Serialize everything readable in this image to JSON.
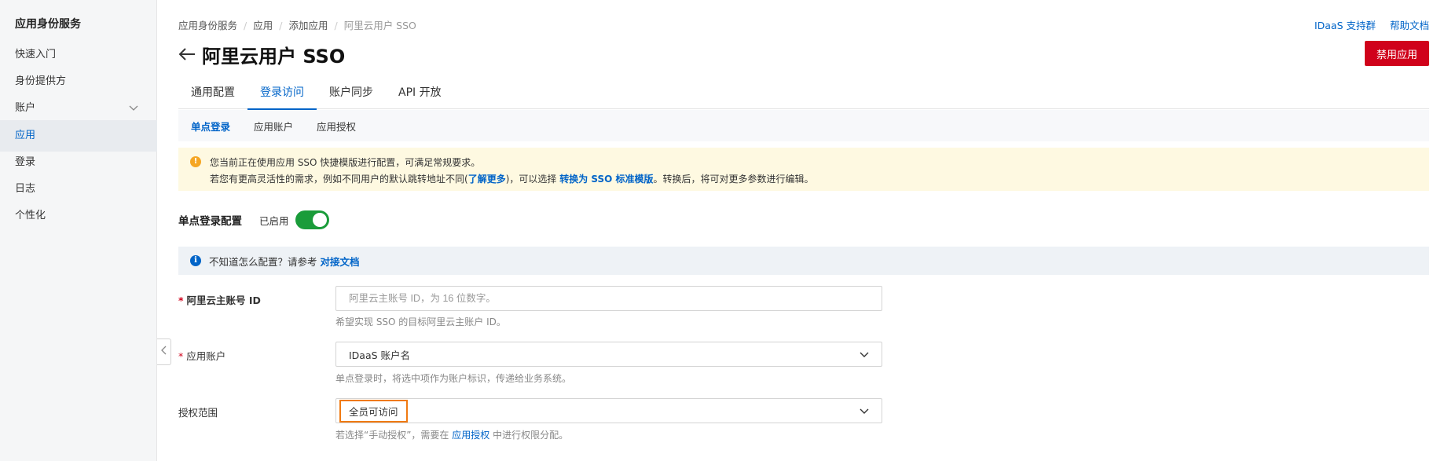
{
  "sidebar": {
    "title": "应用身份服务",
    "items": [
      {
        "label": "快速入门"
      },
      {
        "label": "身份提供方"
      },
      {
        "label": "账户"
      },
      {
        "label": "应用"
      },
      {
        "label": "登录"
      },
      {
        "label": "日志"
      },
      {
        "label": "个性化"
      }
    ],
    "active_item": "应用"
  },
  "breadcrumb": [
    "应用身份服务",
    "应用",
    "添加应用",
    "阿里云用户 SSO"
  ],
  "top_links": {
    "support": "IDaaS 支持群",
    "help": "帮助文档"
  },
  "page": {
    "title": "阿里云用户 SSO",
    "disable_button": "禁用应用"
  },
  "tabs": [
    {
      "label": "通用配置"
    },
    {
      "label": "登录访问"
    },
    {
      "label": "账户同步"
    },
    {
      "label": "API 开放"
    }
  ],
  "subtabs": [
    {
      "label": "单点登录"
    },
    {
      "label": "应用账户"
    },
    {
      "label": "应用授权"
    }
  ],
  "warning": {
    "line1": "您当前正在使用应用 SSO 快捷模版进行配置，可满足常规要求。",
    "line2_a": "若您有更高灵活性的需求，例如不同用户的默认跳转地址不同(",
    "line2_link1": "了解更多",
    "line2_b": ")，可以选择 ",
    "line2_link2": "转换为 SSO 标准模版",
    "line2_c": "。转换后，将可对更多参数进行编辑。"
  },
  "sso": {
    "label": "单点登录配置",
    "status": "已启用",
    "enabled": true
  },
  "info": {
    "text": "不知道怎么配置？请参考",
    "link": "对接文档"
  },
  "form": {
    "account_id": {
      "label": "阿里云主账号 ID",
      "placeholder": "阿里云主账号 ID，为 16 位数字。",
      "value": "",
      "hint": "希望实现 SSO 的目标阿里云主账户 ID。"
    },
    "app_account": {
      "label": "应用账户",
      "value": "IDaaS 账户名",
      "hint": "单点登录时，将选中项作为账户标识，传递给业务系统。"
    },
    "auth_scope": {
      "label": "授权范围",
      "value": "全员可访问",
      "hint_a": "若选择“手动授权”，需要在 ",
      "hint_link": "应用授权",
      "hint_b": " 中进行权限分配。"
    }
  }
}
